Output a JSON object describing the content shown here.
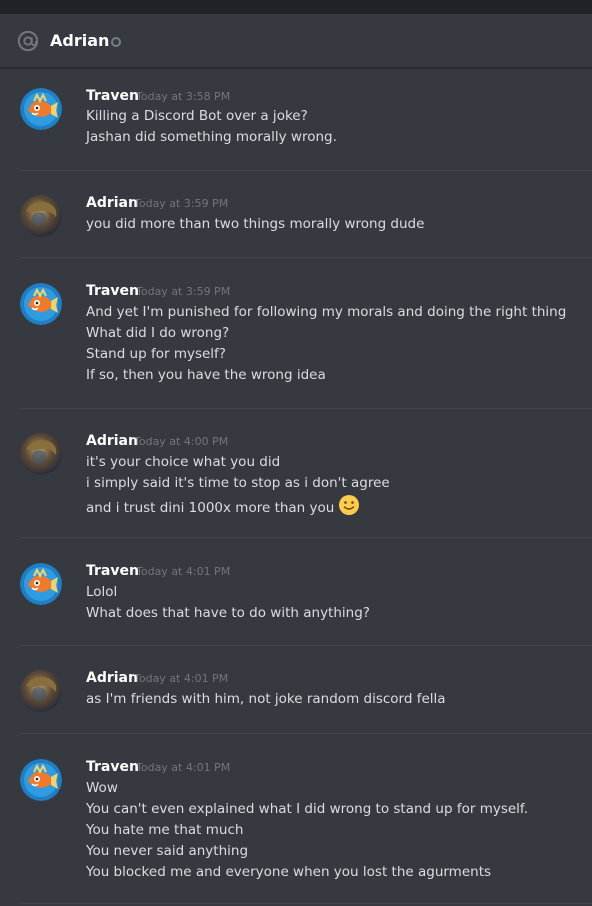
{
  "header": {
    "title": "Adrian",
    "icon": "at-icon",
    "status": "offline"
  },
  "colors": {
    "background": "#36393f",
    "header_text": "#ffffff",
    "message_text": "#dcddde",
    "timestamp": "#72767d",
    "divider": "#42454a"
  },
  "messages": [
    {
      "author": "Traven",
      "timestamp": "Today at 3:58 PM",
      "lines": [
        "Killing a Discord Bot over a joke?",
        "Jashan did something morally wrong."
      ]
    },
    {
      "author": "Adrian",
      "timestamp": "Today at 3:59 PM",
      "lines": [
        "you did more than two things morally wrong dude"
      ]
    },
    {
      "author": "Traven",
      "timestamp": "Today at 3:59 PM",
      "lines": [
        "And yet I'm punished for following my morals and doing the right thing",
        "What did I do wrong?",
        "Stand up for myself?",
        "If so, then you have the wrong idea"
      ]
    },
    {
      "author": "Adrian",
      "timestamp": "Today at 4:00 PM",
      "lines": [
        "it's your choice what you did",
        "i simply said it's time to stop as i don't agree",
        "and i trust dini 1000x more than you"
      ],
      "emoji": "slightly-smiling-face"
    },
    {
      "author": "Traven",
      "timestamp": "Today at 4:01 PM",
      "lines": [
        "Lolol",
        "What does that have to do with anything?"
      ]
    },
    {
      "author": "Adrian",
      "timestamp": "Today at 4:01 PM",
      "lines": [
        "as I'm friends with him, not joke random discord fella"
      ]
    },
    {
      "author": "Traven",
      "timestamp": "Today at 4:01 PM",
      "lines": [
        "Wow",
        "You can't even explained what I did wrong to stand up for myself.",
        "You hate me that much",
        "You never said anything",
        "You blocked me and everyone when you lost the agurments"
      ]
    }
  ]
}
